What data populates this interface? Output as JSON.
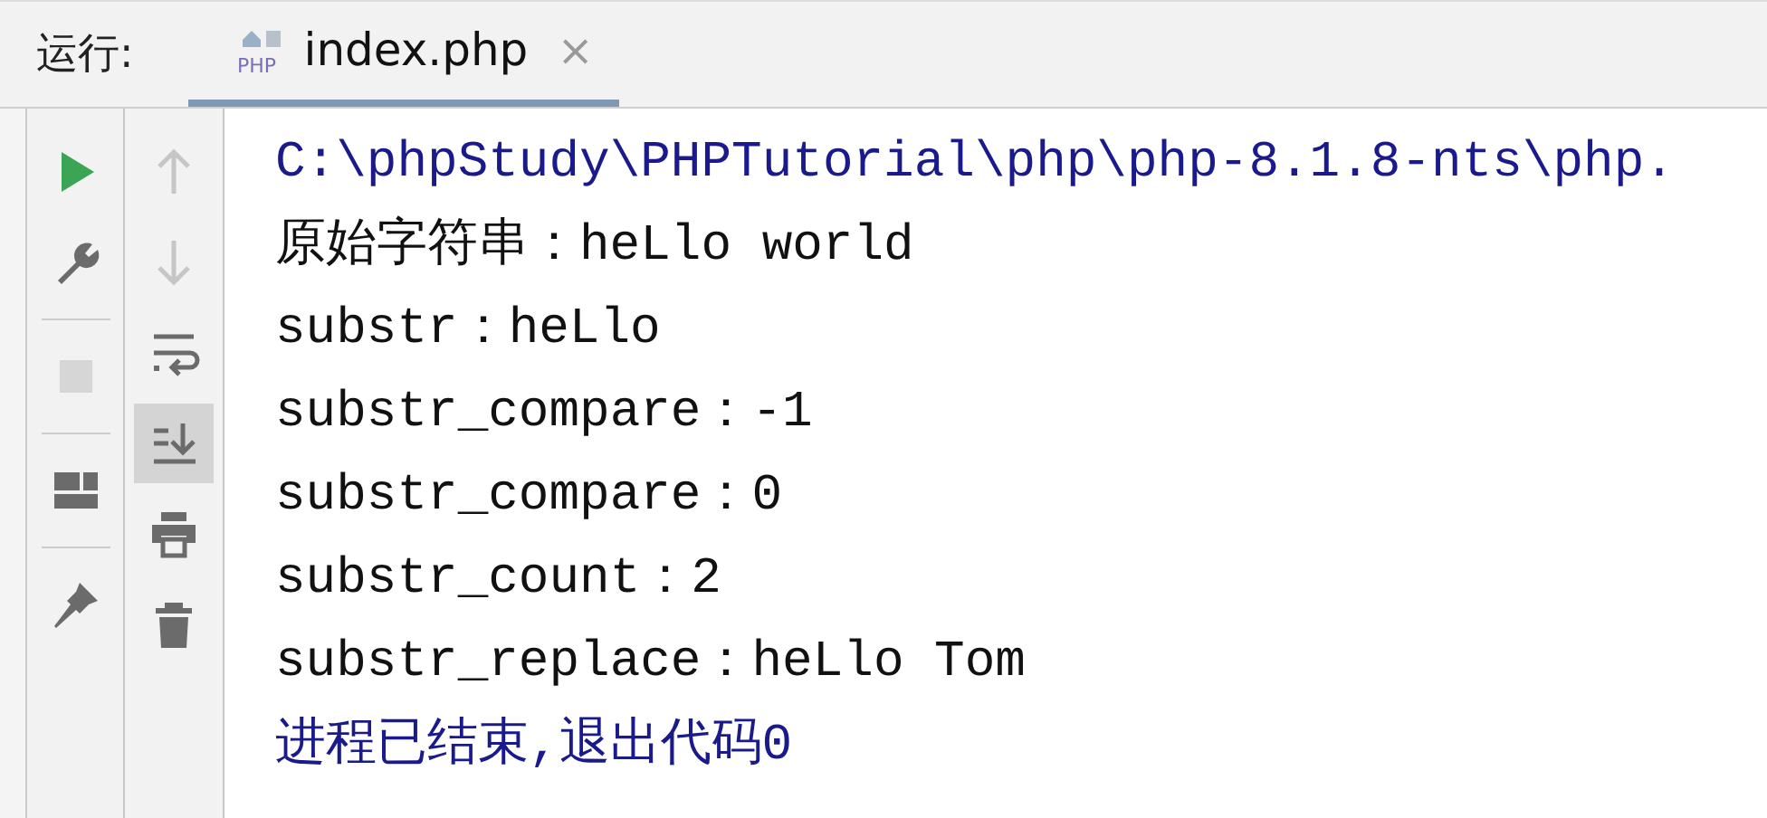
{
  "run_label": "运行:",
  "tabs": [
    {
      "label": "index.php",
      "icon_text": "PHP",
      "selected": true,
      "close": "×"
    }
  ],
  "toolbar_left": [
    {
      "kind": "run",
      "disabled": false
    },
    {
      "kind": "settings",
      "disabled": false
    },
    {
      "kind": "stop",
      "disabled": true
    },
    {
      "kind": "layout",
      "disabled": false
    },
    {
      "kind": "pin",
      "disabled": false
    }
  ],
  "toolbar_right": [
    {
      "kind": "up",
      "disabled": true,
      "selected": false
    },
    {
      "kind": "down",
      "disabled": true,
      "selected": false
    },
    {
      "kind": "wrap",
      "disabled": false,
      "selected": false
    },
    {
      "kind": "scroll-end",
      "disabled": false,
      "selected": true
    },
    {
      "kind": "print",
      "disabled": false,
      "selected": false
    },
    {
      "kind": "delete",
      "disabled": false,
      "selected": false
    }
  ],
  "console": [
    {
      "kind": "command",
      "text": "C:\\phpStudy\\PHPTutorial\\php\\php-8.1.8-nts\\php."
    },
    {
      "kind": "output",
      "text": "原始字符串：heLlo world"
    },
    {
      "kind": "output",
      "text": "substr：heLlo"
    },
    {
      "kind": "output",
      "text": "substr_compare：-1"
    },
    {
      "kind": "output",
      "text": "substr_compare：0"
    },
    {
      "kind": "output",
      "text": "substr_count：2"
    },
    {
      "kind": "output",
      "text": "substr_replace：heLlo Tom"
    },
    {
      "kind": "exit",
      "text": "进程已结束,退出代码0"
    }
  ]
}
